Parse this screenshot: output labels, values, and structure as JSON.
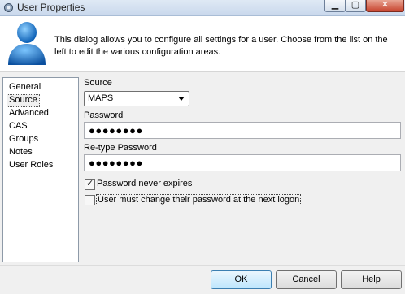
{
  "window": {
    "title": "User Properties"
  },
  "header": {
    "description": "This dialog allows you to configure all settings for a user.  Choose from the list on the left to edit the various configuration areas."
  },
  "nav": {
    "items": [
      "General",
      "Source",
      "Advanced",
      "CAS",
      "Groups",
      "Notes",
      "User Roles"
    ],
    "selected": "Source"
  },
  "form": {
    "source_label": "Source",
    "source_value": "MAPS",
    "password_label": "Password",
    "password_value": "●●●●●●●●",
    "retype_label": "Re-type Password",
    "retype_value": "●●●●●●●●",
    "never_expires_label": "Password never expires",
    "never_expires_checked": true,
    "must_change_label": "User must change their password at the next logon",
    "must_change_checked": false
  },
  "buttons": {
    "ok": "OK",
    "cancel": "Cancel",
    "help": "Help"
  }
}
